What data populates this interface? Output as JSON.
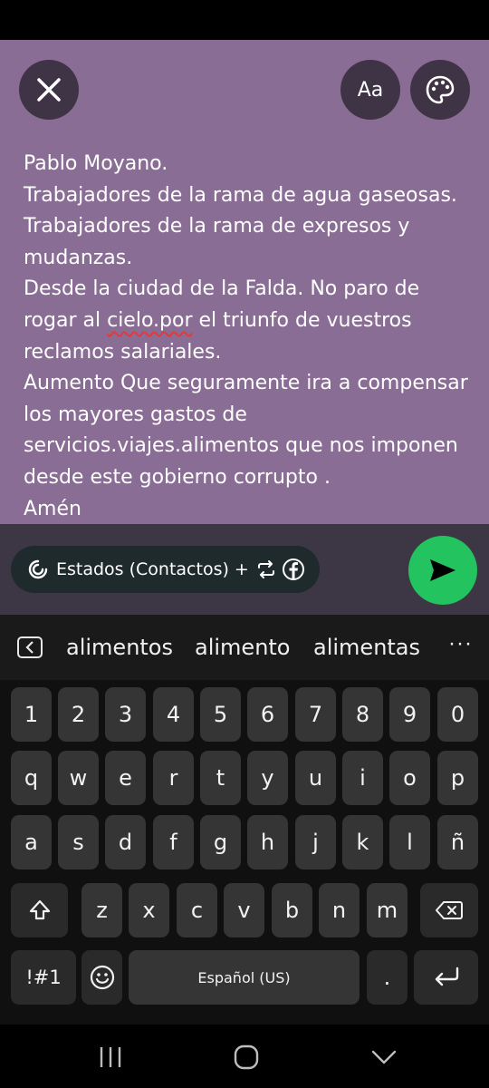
{
  "compose": {
    "close_icon": "close-icon",
    "font_label": "Aa",
    "palette_icon": "palette-icon",
    "text_before": "Pablo Moyano.\nTrabajadores de la rama de agua gaseosas.\nTrabajadores de la rama de expresos y mudanzas.\nDesde la ciudad de la Falda. No paro de rogar al ",
    "text_misspelled": "cielo.por",
    "text_after": " el triunfo de vuestros reclamos salariales.\nAumento Que seguramente ira a compensar los mayores gastos de servicios.viajes.alimentos que nos imponen desde este gobierno corrupto .\nAmén",
    "background_color": "#8a6d94"
  },
  "send_bar": {
    "audience_label": "Estados (Contactos) +",
    "status_icon": "status-ring-icon",
    "share_icon": "repeat-icon",
    "facebook_icon": "facebook-icon",
    "send_icon": "send-icon",
    "send_color": "#23c45f"
  },
  "keyboard": {
    "suggestions": [
      "alimentos",
      "alimento",
      "alimentas"
    ],
    "more_label": "···",
    "number_row": [
      "1",
      "2",
      "3",
      "4",
      "5",
      "6",
      "7",
      "8",
      "9",
      "0"
    ],
    "row1": [
      "q",
      "w",
      "e",
      "r",
      "t",
      "y",
      "u",
      "i",
      "o",
      "p"
    ],
    "row2": [
      "a",
      "s",
      "d",
      "f",
      "g",
      "h",
      "j",
      "k",
      "l",
      "ñ"
    ],
    "row3": [
      "z",
      "x",
      "c",
      "v",
      "b",
      "n",
      "m"
    ],
    "symbols_label": "!#1",
    "space_label": "Español (US)",
    "period_label": "."
  },
  "nav": {
    "recents_icon": "recents-icon",
    "home_icon": "home-icon",
    "back_icon": "back-chevron-icon"
  }
}
